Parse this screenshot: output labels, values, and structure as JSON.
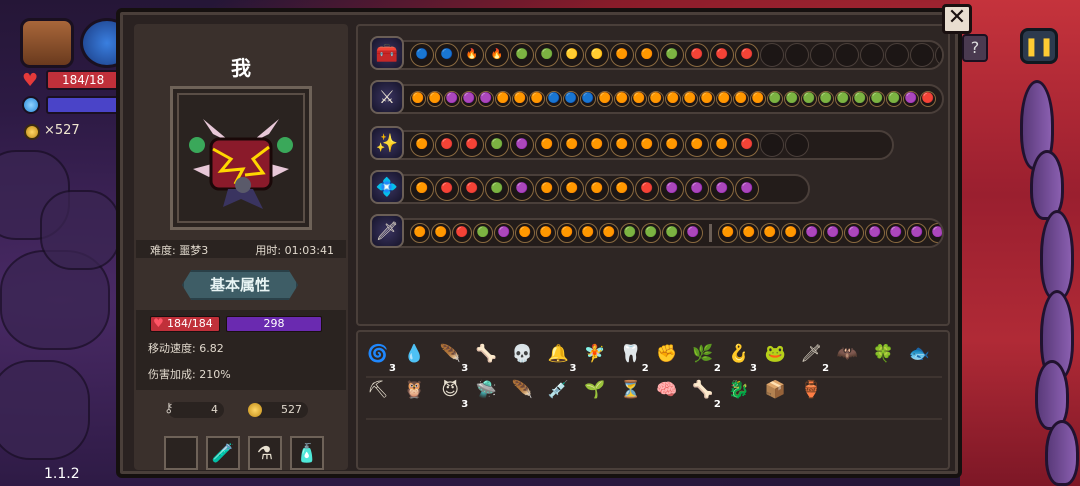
{
  "hud": {
    "hp_text": "184/18",
    "coins_text": "×527",
    "version": "1.1.2",
    "pause_icon": "pause-icon",
    "help_icon": "?"
  },
  "panel": {
    "close_label": "✕",
    "player_name": "我",
    "difficulty": "难度: 噩梦3",
    "time_used": "用时: 01:03:41",
    "attr_title": "基本属性",
    "hp": "184/184",
    "mp": "298",
    "move_speed": "移动速度: 6.82",
    "damage_bonus": "伤害加成: 210%",
    "keys": "4",
    "coins": "527"
  },
  "slots": [
    "",
    "🧪",
    "⚗",
    "🧴"
  ],
  "colors": {
    "hp": "#c0303a",
    "mp": "#6a2ab0",
    "panel": "#2a2221",
    "accent": "#ffcc33"
  },
  "weapon_rows": [
    {
      "head": "🧰",
      "gems": [
        "🔵",
        "🔵",
        "🔥",
        "🔥",
        "🟢",
        "🟢",
        "🟡",
        "🟡",
        "🟠",
        "🟠",
        "🟢",
        "🔴",
        "🔴",
        "🔴",
        "",
        "",
        "",
        "",
        "",
        "",
        "",
        ""
      ]
    },
    {
      "head": "⚔",
      "gems": [
        "🟠",
        "🟠",
        "🟣",
        "🟣",
        "🟣",
        "🟠",
        "🟠",
        "🟠",
        "🔵",
        "🔵",
        "🔵",
        "🟠",
        "🟠",
        "🟠",
        "🟠",
        "🟠",
        "🟠",
        "🟠",
        "🟠",
        "🟠",
        "🟠",
        "🟢",
        "🟢",
        "🟢",
        "🟢",
        "🟢",
        "🟢",
        "🟢",
        "🟢",
        "🟣",
        "🔴"
      ]
    },
    {
      "head": "✨",
      "gems": [
        "🟠",
        "🔴",
        "🔴",
        "🟢",
        "🟣",
        "🟠",
        "🟠",
        "🟠",
        "🟠",
        "🟠",
        "🟠",
        "🟠",
        "🟠",
        "🔴",
        "",
        ""
      ]
    },
    {
      "head": "💠",
      "gems": [
        "🟠",
        "🔴",
        "🔴",
        "🟢",
        "🟣",
        "🟠",
        "🟠",
        "🟠",
        "🟠",
        "🔴",
        "🟣",
        "🟣",
        "🟣",
        "🟣"
      ]
    },
    {
      "head": "🗡",
      "gems": [
        "🟠",
        "🟠",
        "🔴",
        "🟢",
        "🟣",
        "🟠",
        "🟠",
        "🟠",
        "🟠",
        "🟠",
        "🟢",
        "🟢",
        "🟢",
        "🟣"
      ],
      "gems2": [
        "🟠",
        "🟠",
        "🟠",
        "🟠",
        "🟣",
        "🟣",
        "🟣",
        "🟣",
        "🟣",
        "🟣",
        "🟣",
        "🟣",
        "🔴",
        "🔴"
      ]
    }
  ],
  "items": [
    {
      "g": "🌀",
      "c": "3"
    },
    {
      "g": "💧",
      "c": ""
    },
    {
      "g": "🪶",
      "c": "3"
    },
    {
      "g": "🦴",
      "c": ""
    },
    {
      "g": "💀",
      "c": ""
    },
    {
      "g": "🔔",
      "c": "3"
    },
    {
      "g": "🧚",
      "c": ""
    },
    {
      "g": "🦷",
      "c": "2"
    },
    {
      "g": "✊",
      "c": ""
    },
    {
      "g": "🌿",
      "c": "2"
    },
    {
      "g": "🪝",
      "c": "3"
    },
    {
      "g": "🐸",
      "c": ""
    },
    {
      "g": "🗡",
      "c": "2"
    },
    {
      "g": "🦇",
      "c": ""
    },
    {
      "g": "🍀",
      "c": ""
    },
    {
      "g": "🐟",
      "c": ""
    },
    {
      "g": "⛏",
      "c": ""
    },
    {
      "g": "🦉",
      "c": ""
    },
    {
      "g": "😈",
      "c": "3"
    },
    {
      "g": "🛸",
      "c": ""
    },
    {
      "g": "🪶",
      "c": ""
    },
    {
      "g": "💉",
      "c": ""
    },
    {
      "g": "🌱",
      "c": ""
    },
    {
      "g": "⏳",
      "c": ""
    },
    {
      "g": "🧠",
      "c": ""
    },
    {
      "g": "🦴",
      "c": "2"
    },
    {
      "g": "🐉",
      "c": ""
    },
    {
      "g": "📦",
      "c": ""
    },
    {
      "g": "🏺",
      "c": ""
    }
  ]
}
